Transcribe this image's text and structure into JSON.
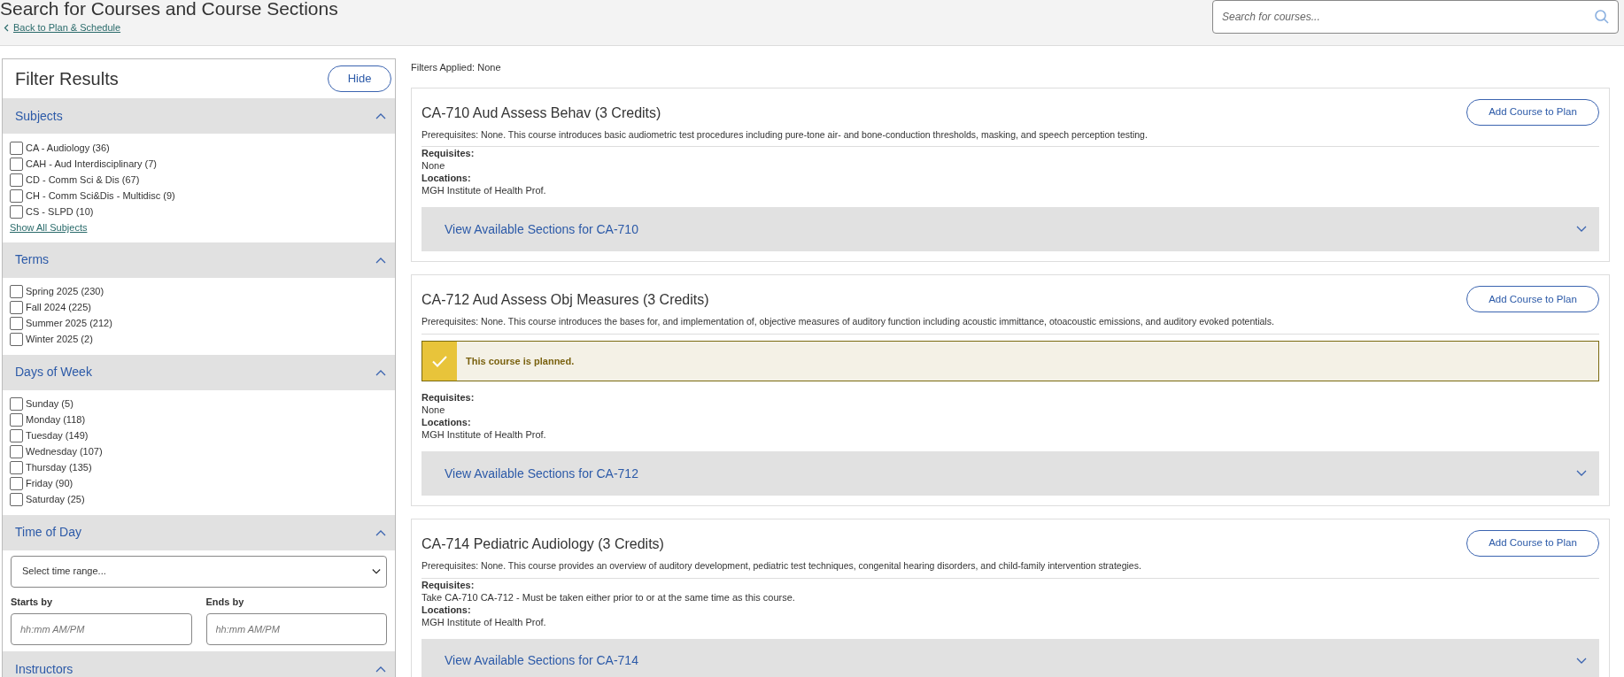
{
  "page": {
    "title": "Search for Courses and Course Sections",
    "back_link": "Back to Plan & Schedule"
  },
  "search": {
    "placeholder": "Search for courses..."
  },
  "filters": {
    "title": "Filter Results",
    "hide_button": "Hide",
    "groups": [
      {
        "kind": "checkboxes",
        "title": "Subjects",
        "expanded": true,
        "options": [
          {
            "label": "CA - Audiology (36)",
            "checked": false
          },
          {
            "label": "CAH - Aud Interdisciplinary (7)",
            "checked": false
          },
          {
            "label": "CD - Comm Sci & Dis (67)",
            "checked": false
          },
          {
            "label": "CH - Comm Sci&Dis - Multidisc (9)",
            "checked": false
          },
          {
            "label": "CS - SLPD (10)",
            "checked": false
          }
        ],
        "show_all": "Show All Subjects"
      },
      {
        "kind": "checkboxes",
        "title": "Terms",
        "expanded": true,
        "options": [
          {
            "label": "Spring 2025 (230)",
            "checked": false
          },
          {
            "label": "Fall 2024 (225)",
            "checked": false
          },
          {
            "label": "Summer 2025 (212)",
            "checked": false
          },
          {
            "label": "Winter 2025 (2)",
            "checked": false
          }
        ]
      },
      {
        "kind": "checkboxes",
        "title": "Days of Week",
        "expanded": true,
        "options": [
          {
            "label": "Sunday (5)",
            "checked": false
          },
          {
            "label": "Monday (118)",
            "checked": false
          },
          {
            "label": "Tuesday (149)",
            "checked": false
          },
          {
            "label": "Wednesday (107)",
            "checked": false
          },
          {
            "label": "Thursday (135)",
            "checked": false
          },
          {
            "label": "Friday (90)",
            "checked": false
          },
          {
            "label": "Saturday (25)",
            "checked": false
          }
        ]
      },
      {
        "kind": "time",
        "title": "Time of Day",
        "expanded": true,
        "select": "Select time range...",
        "starts": {
          "label": "Starts by",
          "placeholder": "hh:mm AM/PM"
        },
        "ends": {
          "label": "Ends by",
          "placeholder": "hh:mm AM/PM"
        }
      },
      {
        "kind": "checkboxes",
        "title": "Instructors",
        "expanded": true
      }
    ]
  },
  "filters_applied": "Filters Applied: None",
  "courses": [
    {
      "title": "CA-710 Aud Assess Behav (3 Credits)",
      "description": "Prerequisites: None. This course introduces basic audiometric test procedures including pure-tone air- and bone-conduction thresholds, masking, and speech perception testing.",
      "planned": false,
      "requisites_label": "Requisites:",
      "requisites": "None",
      "locations_label": "Locations:",
      "locations": "MGH Institute of Health Prof.",
      "sections_link": "View Available Sections for CA-710",
      "sections_expanded": false,
      "add_button": "Add Course to Plan"
    },
    {
      "title": "CA-712 Aud Assess Obj Measures (3 Credits)",
      "description": "Prerequisites: None. This course introduces the bases for, and implementation of, objective measures of auditory function including acoustic immittance, otoacoustic emissions, and auditory evoked potentials.",
      "planned": true,
      "planned_message": "This course is planned.",
      "requisites_label": "Requisites:",
      "requisites": "None",
      "locations_label": "Locations:",
      "locations": "MGH Institute of Health Prof.",
      "sections_link": "View Available Sections for CA-712",
      "sections_expanded": false,
      "add_button": "Add Course to Plan"
    },
    {
      "title": "CA-714 Pediatric Audiology (3 Credits)",
      "description": "Prerequisites: None. This course provides an overview of auditory development, pediatric test techniques, congenital hearing disorders, and child-family intervention strategies.",
      "planned": false,
      "requisites_label": "Requisites:",
      "requisites": "Take CA-710 CA-712 - Must be taken either prior to or at the same time as this course.",
      "locations_label": "Locations:",
      "locations": "MGH Institute of Health Prof.",
      "sections_link": "View Available Sections for CA-714",
      "sections_expanded": false,
      "add_button": "Add Course to Plan"
    }
  ]
}
